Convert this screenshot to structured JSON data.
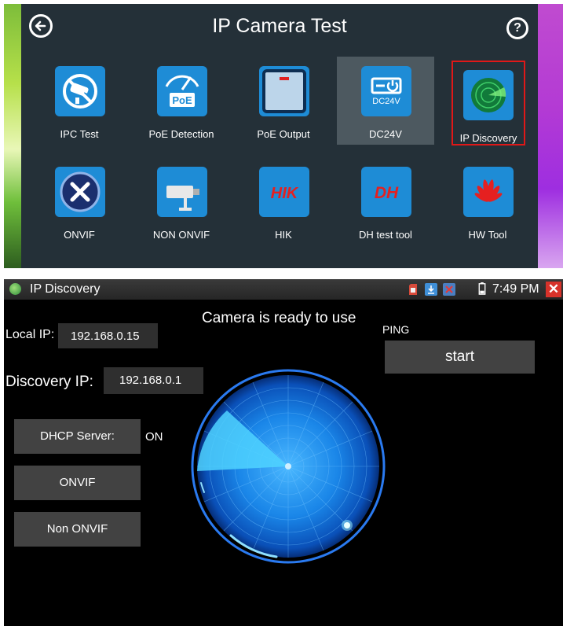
{
  "launcher": {
    "title": "IP Camera Test",
    "back_icon": "back-arrow-icon",
    "help_icon": "question-icon",
    "help_glyph": "?",
    "tiles": [
      {
        "label": "IPC Test",
        "icon": "ipc-camera-icon"
      },
      {
        "label": "PoE Detection",
        "icon": "poe-meter-icon",
        "icon_text": "PoE"
      },
      {
        "label": "PoE Output",
        "icon": "poe-output-icon"
      },
      {
        "label": "DC24V",
        "icon": "dc24v-icon",
        "icon_text": "DC24V"
      },
      {
        "label": "IP Discovery",
        "icon": "radar-icon"
      },
      {
        "label": "ONVIF",
        "icon": "onvif-tools-icon"
      },
      {
        "label": "NON ONVIF",
        "icon": "cctv-camera-icon"
      },
      {
        "label": "HIK",
        "icon": "hik-logo-icon",
        "icon_text": "HIK"
      },
      {
        "label": "DH test tool",
        "icon": "dh-logo-icon",
        "icon_text": "DH"
      },
      {
        "label": "HW Tool",
        "icon": "huawei-logo-icon"
      }
    ],
    "selected_tile": "DC24V",
    "highlighted_tile": "IP Discovery"
  },
  "status_bar": {
    "app_title": "IP Discovery",
    "time": "7:49 PM",
    "icons": [
      "sd-card-icon",
      "download-icon",
      "no-signal-icon",
      "battery-icon",
      "close-icon"
    ],
    "close_glyph": "✕"
  },
  "discovery": {
    "status_message": "Camera is ready to use",
    "local_ip_label": "Local IP:",
    "local_ip": "192.168.0.15",
    "discovery_ip_label": "Discovery IP:",
    "discovery_ip": "192.168.0.1",
    "ping_label": "PING",
    "start_label": "start",
    "dhcp_button": "DHCP Server:",
    "dhcp_state": "ON",
    "onvif_button": "ONVIF",
    "non_onvif_button": "Non ONVIF"
  },
  "colors": {
    "panel_bg": "#243038",
    "tile_icon_bg": "#1e8cd6",
    "highlight_border": "#e01818",
    "button_bg": "#424242",
    "radar_blue": "#1a8ef0"
  }
}
